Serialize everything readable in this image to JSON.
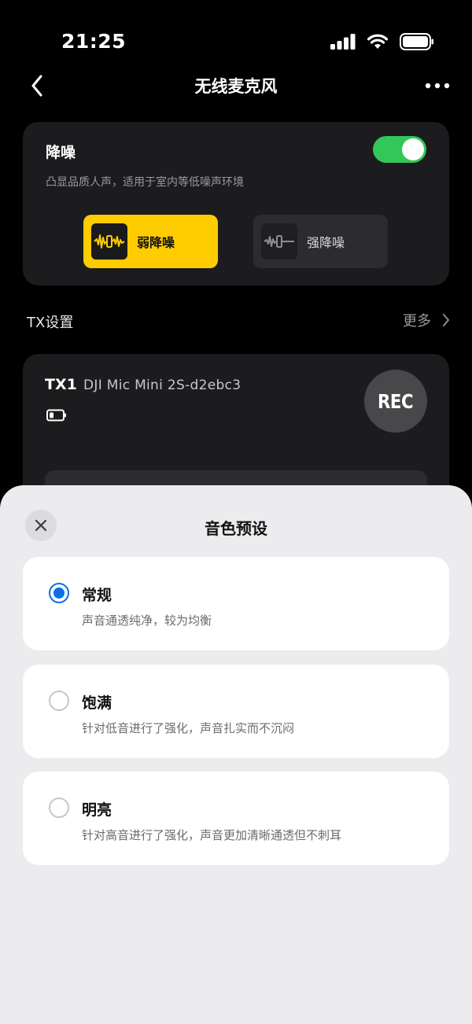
{
  "status_bar": {
    "time": "21:25"
  },
  "nav": {
    "title": "无线麦克风"
  },
  "noise_reduction": {
    "title": "降噪",
    "description": "凸显品质人声，适用于室内等低噪声环境",
    "enabled": true,
    "toggle_color": "#33c759",
    "modes": [
      {
        "label": "弱降噪",
        "selected": true,
        "accent": "#ffcc00"
      },
      {
        "label": "强降噪",
        "selected": false
      }
    ]
  },
  "tx_settings": {
    "label": "TX设置",
    "more_label": "更多",
    "device": {
      "name": "TX1",
      "model": "DJI Mic Mini 2S-d2ebc3",
      "rec_label": "REC"
    }
  },
  "sheet": {
    "title": "音色预设",
    "accent": "#0a6ee8",
    "options": [
      {
        "title": "常规",
        "description": "声音通透纯净，较为均衡",
        "selected": true
      },
      {
        "title": "饱满",
        "description": "针对低音进行了强化，声音扎实而不沉闷",
        "selected": false
      },
      {
        "title": "明亮",
        "description": "针对高音进行了强化，声音更加清晰通透但不刺耳",
        "selected": false
      }
    ]
  }
}
